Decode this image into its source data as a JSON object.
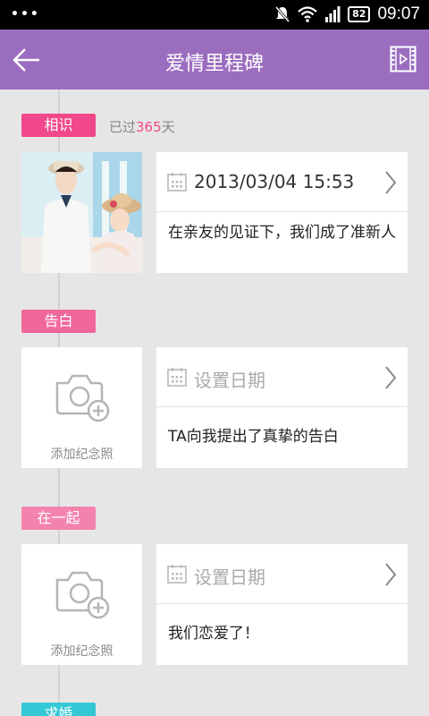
{
  "status_bar": {
    "time": "09:07",
    "battery": "82",
    "dots": "•••"
  },
  "header": {
    "title": "爱情里程碑"
  },
  "milestones": [
    {
      "tag": "相识",
      "elapsed_prefix": "已过",
      "elapsed_days": "365",
      "elapsed_suffix": "天",
      "date": "2013/03/04  15:53",
      "description": "在亲友的见证下，我们成了准新人"
    },
    {
      "tag": "告白",
      "photo_caption": "添加纪念照",
      "date": "设置日期",
      "description": "TA向我提出了真挚的告白"
    },
    {
      "tag": "在一起",
      "photo_caption": "添加纪念照",
      "date": "设置日期",
      "description": "我们恋爱了！"
    },
    {
      "tag": "求婚"
    }
  ],
  "colors": {
    "header": "#9b6dbf",
    "tag1": "#f0488a",
    "tag2": "#f0679a",
    "tag3": "#f383ad",
    "tag4": "#33c8d6"
  },
  "icons": [
    "back-arrow-icon",
    "movie-icon",
    "calendar-icon",
    "chevron-right-icon",
    "camera-add-icon",
    "mute-icon",
    "wifi-icon",
    "signal-icon"
  ]
}
